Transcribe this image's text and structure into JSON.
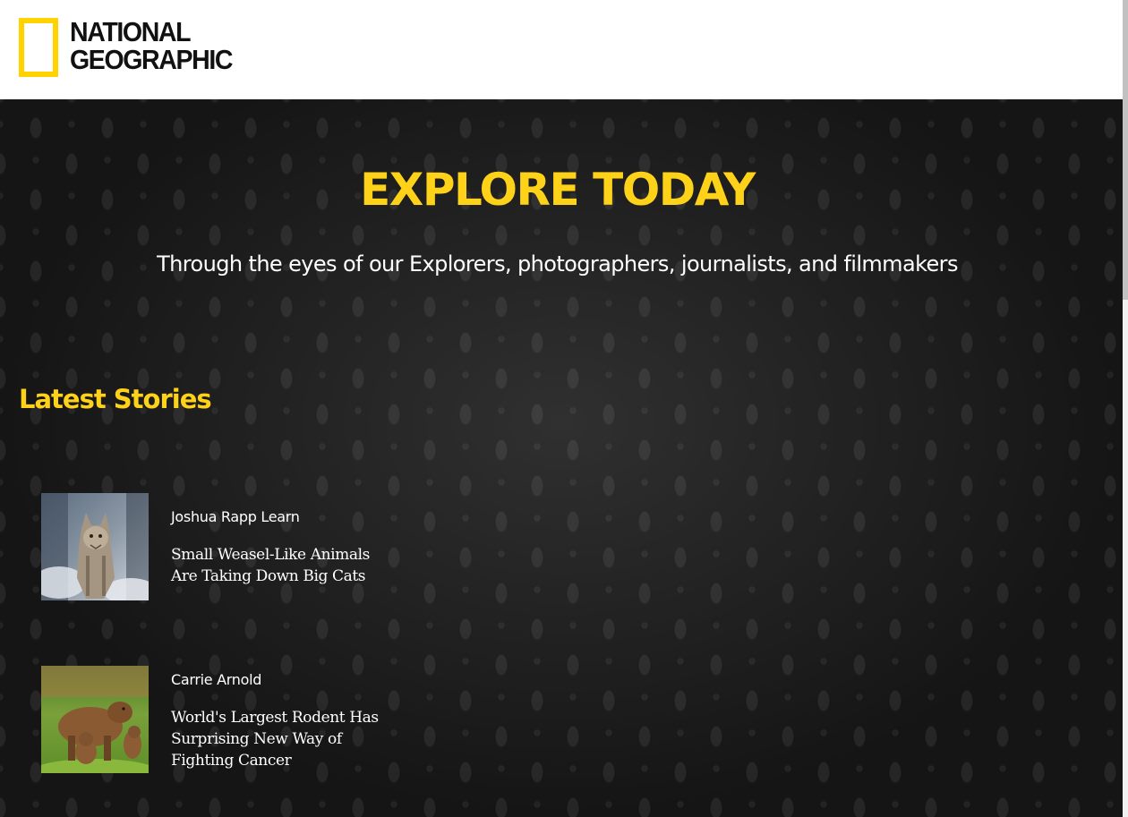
{
  "header": {
    "logo": {
      "line1": "NATIONAL",
      "line2": "GEOGRAPHIC",
      "frame_color": "#ffd200"
    }
  },
  "hero": {
    "title": "EXPLORE TODAY",
    "subtitle": "Through the eyes of our Explorers, photographers, journalists, and filmmakers",
    "accent_color": "#ffd21a"
  },
  "latest": {
    "heading": "Latest Stories",
    "stories": [
      {
        "author": "Joshua Rapp Learn",
        "headline": "Small Weasel-Like Animals Are Taking Down Big Cats",
        "thumbnail_icon": "lynx-photo"
      },
      {
        "author": "Carrie Arnold",
        "headline": "World's Largest Rodent Has Surprising New Way of Fighting Cancer",
        "thumbnail_icon": "capybara-photo"
      }
    ]
  }
}
